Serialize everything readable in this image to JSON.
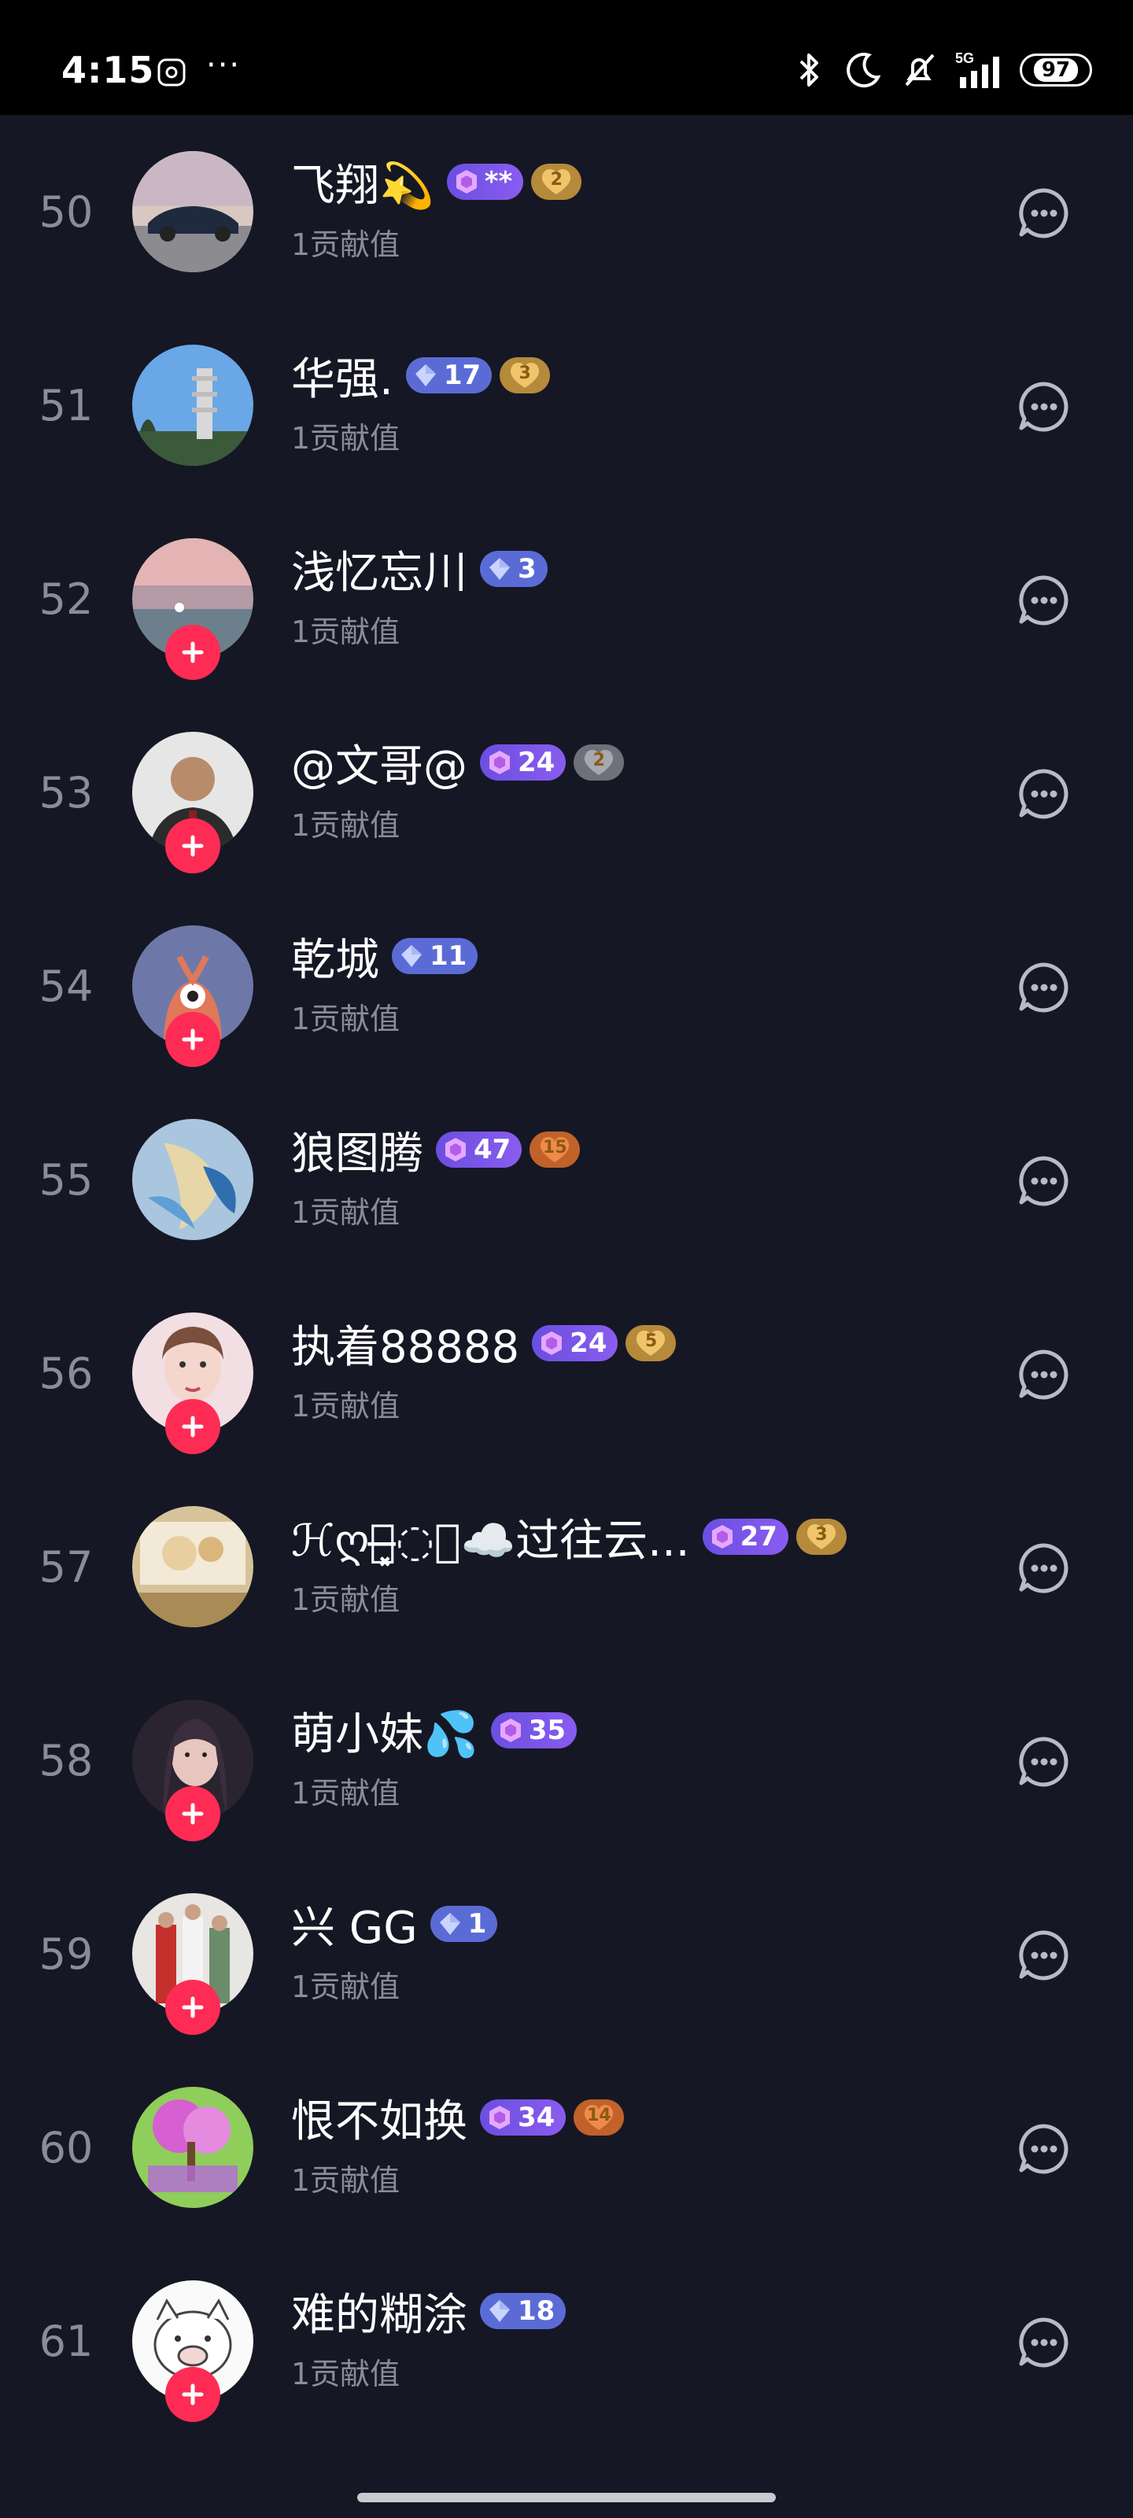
{
  "status_bar": {
    "time": "4:15",
    "dots": "···",
    "network": "5G",
    "battery": "97"
  },
  "colors": {
    "background": "#161724",
    "follow_button": "#fe2c55",
    "level_badge": "#5b6bd6",
    "fan_badge": "#b58a3a"
  },
  "rows": [
    {
      "rank": "50",
      "name": "飞翔💫",
      "badge_level": "**",
      "badge_style": "purple",
      "fan_level": "2",
      "fan_style": "gold",
      "contribution": "1贡献值",
      "follow": false,
      "avatar": "car"
    },
    {
      "rank": "51",
      "name": "华强.",
      "badge_level": "17",
      "badge_style": "blue",
      "fan_level": "3",
      "fan_style": "gold",
      "contribution": "1贡献值",
      "follow": false,
      "avatar": "pagoda"
    },
    {
      "rank": "52",
      "name": "浅忆忘川",
      "badge_level": "3",
      "badge_style": "blue",
      "fan_level": "",
      "fan_style": "",
      "contribution": "1贡献值",
      "follow": true,
      "avatar": "sunset"
    },
    {
      "rank": "53",
      "name": "@文哥@",
      "badge_level": "24",
      "badge_style": "purple",
      "fan_level": "2",
      "fan_style": "grey",
      "contribution": "1贡献值",
      "follow": true,
      "avatar": "man"
    },
    {
      "rank": "54",
      "name": "乾城",
      "badge_level": "11",
      "badge_style": "blue",
      "fan_level": "",
      "fan_style": "",
      "contribution": "1贡献值",
      "follow": true,
      "avatar": "cartoon"
    },
    {
      "rank": "55",
      "name": "狼图腾",
      "badge_level": "47",
      "badge_style": "purple",
      "fan_level": "15",
      "fan_style": "orange",
      "contribution": "1贡献值",
      "follow": false,
      "avatar": "fish"
    },
    {
      "rank": "56",
      "name": "执着88888",
      "badge_level": "24",
      "badge_style": "purple",
      "fan_level": "5",
      "fan_style": "gold",
      "contribution": "1贡献值",
      "follow": true,
      "avatar": "woman"
    },
    {
      "rank": "57",
      "name": "ℋღ⃝̶̶̶̶̶̶͓͓͓͓͓◌⃝☁️过往云...",
      "badge_level": "27",
      "badge_style": "purple",
      "fan_level": "3",
      "fan_style": "gold",
      "contribution": "1贡献值",
      "follow": false,
      "avatar": "room"
    },
    {
      "rank": "58",
      "name": "萌小妹💦",
      "badge_level": "35",
      "badge_style": "purple",
      "fan_level": "",
      "fan_style": "",
      "contribution": "1贡献值",
      "follow": true,
      "avatar": "girl"
    },
    {
      "rank": "59",
      "name": "兴 GG",
      "badge_level": "1",
      "badge_style": "blue",
      "fan_level": "",
      "fan_style": "",
      "contribution": "1贡献值",
      "follow": true,
      "avatar": "people"
    },
    {
      "rank": "60",
      "name": "恨不如换",
      "badge_level": "34",
      "badge_style": "purple",
      "fan_level": "14",
      "fan_style": "orange",
      "contribution": "1贡献值",
      "follow": false,
      "avatar": "tree"
    },
    {
      "rank": "61",
      "name": "难的糊涂",
      "badge_level": "18",
      "badge_style": "blue",
      "fan_level": "",
      "fan_style": "",
      "contribution": "1贡献值",
      "follow": true,
      "avatar": "pig"
    }
  ]
}
